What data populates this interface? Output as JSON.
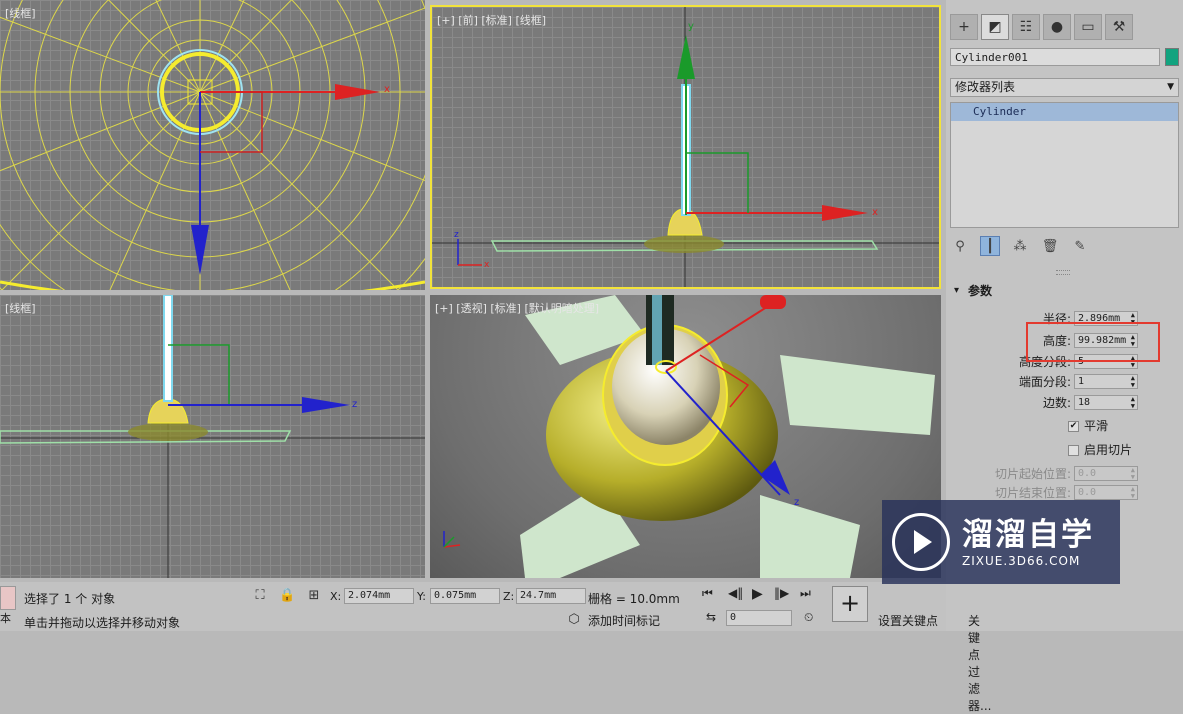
{
  "viewports": {
    "top_left": {
      "label": "[线框]"
    },
    "front": {
      "label": "[+] [前] [标准] [线框]"
    },
    "left": {
      "label": "[线框]"
    },
    "perspective": {
      "label": "[+] [透视] [标准] [默认明暗处理]"
    }
  },
  "axis_letters": {
    "x": "x",
    "y": "y",
    "z": "z"
  },
  "panel": {
    "tab_icons": [
      "create-icon",
      "modify-icon",
      "hierarchy-icon",
      "motion-icon",
      "display-icon",
      "utilities-icon"
    ],
    "object_name": "Cylinder001",
    "object_color": "#11a37f",
    "modifier_list": "修改器列表",
    "stack_item": "Cylinder",
    "rollout_title": "参数",
    "params": {
      "radius_label": "半径:",
      "radius_value": "2.896mm",
      "height_label": "高度:",
      "height_value": "99.982mm",
      "height_segs_label": "高度分段:",
      "height_segs_value": "5",
      "cap_segs_label": "端面分段:",
      "cap_segs_value": "1",
      "sides_label": "边数:",
      "sides_value": "18",
      "smooth_label": "平滑",
      "slice_on_label": "启用切片",
      "slice_from_label": "切片起始位置:",
      "slice_from_value": "0.0",
      "slice_to_label": "切片结束位置:",
      "slice_to_value": "0.0"
    }
  },
  "status": {
    "selection": "选择了 1 个 对象",
    "prompt": "单击并拖动以选择并移动对象",
    "x_label": "X:",
    "x_value": "2.074mm",
    "y_label": "Y:",
    "y_value": "0.075mm",
    "z_label": "Z:",
    "z_value": "24.7mm",
    "grid": "栅格 = 10.0mm",
    "add_time_tag": "添加时间标记",
    "frame_value": "0",
    "set_key": "设置关键点",
    "key_filters": "关键点过滤器...",
    "left_cut": "本"
  },
  "watermark": {
    "title": "溜溜自学",
    "url": "ZIXUE.3D66.COM"
  },
  "colors": {
    "highlight": "#e33a2f",
    "active_border": "#f2e33a",
    "wire": "#e8e040"
  }
}
